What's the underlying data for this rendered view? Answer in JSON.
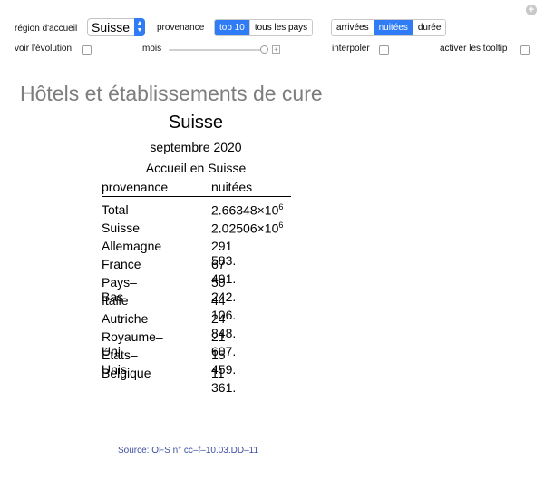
{
  "controls": {
    "region_label": "région d'accueil",
    "region_value": "Suisse",
    "provenance_label": "provenance",
    "provenance_options": [
      "top 10",
      "tous les pays"
    ],
    "provenance_selected": "top 10",
    "measure_options": [
      "arrivées",
      "nuitées",
      "durée"
    ],
    "measure_selected": "nuitées",
    "evolution_label": "voir l'évolution",
    "evolution_checked": false,
    "month_label": "mois",
    "interpolate_label": "interpoler",
    "interpolate_checked": false,
    "tooltip_label": "activer les tooltip",
    "tooltip_checked": false
  },
  "output": {
    "heading": "Hôtels et établissements de cure",
    "region": "Suisse",
    "date": "septembre 2020",
    "subtitle": "Accueil en Suisse",
    "col_origin": "provenance",
    "col_nights": "nuitées",
    "rows": [
      {
        "origin": "Total",
        "mantissa": "2.66348",
        "times": "×",
        "base": "10",
        "exp": "6"
      },
      {
        "origin": "Suisse",
        "mantissa": "2.02506",
        "times": "×",
        "base": "10",
        "exp": "6"
      },
      {
        "origin": "Allemagne",
        "mantissa": "291 583."
      },
      {
        "origin": "France",
        "mantissa": "67 491."
      },
      {
        "origin": "Pays–Bas",
        "mantissa": "50 242."
      },
      {
        "origin": "Italie",
        "mantissa": "44 106."
      },
      {
        "origin": "Autriche",
        "mantissa": "24 848."
      },
      {
        "origin": "Royaume–Uni",
        "mantissa": "21 607."
      },
      {
        "origin": "États–Unis",
        "mantissa": "15 459."
      },
      {
        "origin": "Belgique",
        "mantissa": "11 361."
      }
    ],
    "source": "Source: OFS n° cc–f–10.03.DD–11"
  },
  "colors": {
    "accent": "#2f7cf6",
    "heading": "#7d7d7d",
    "source_link": "#3e4fa3"
  }
}
